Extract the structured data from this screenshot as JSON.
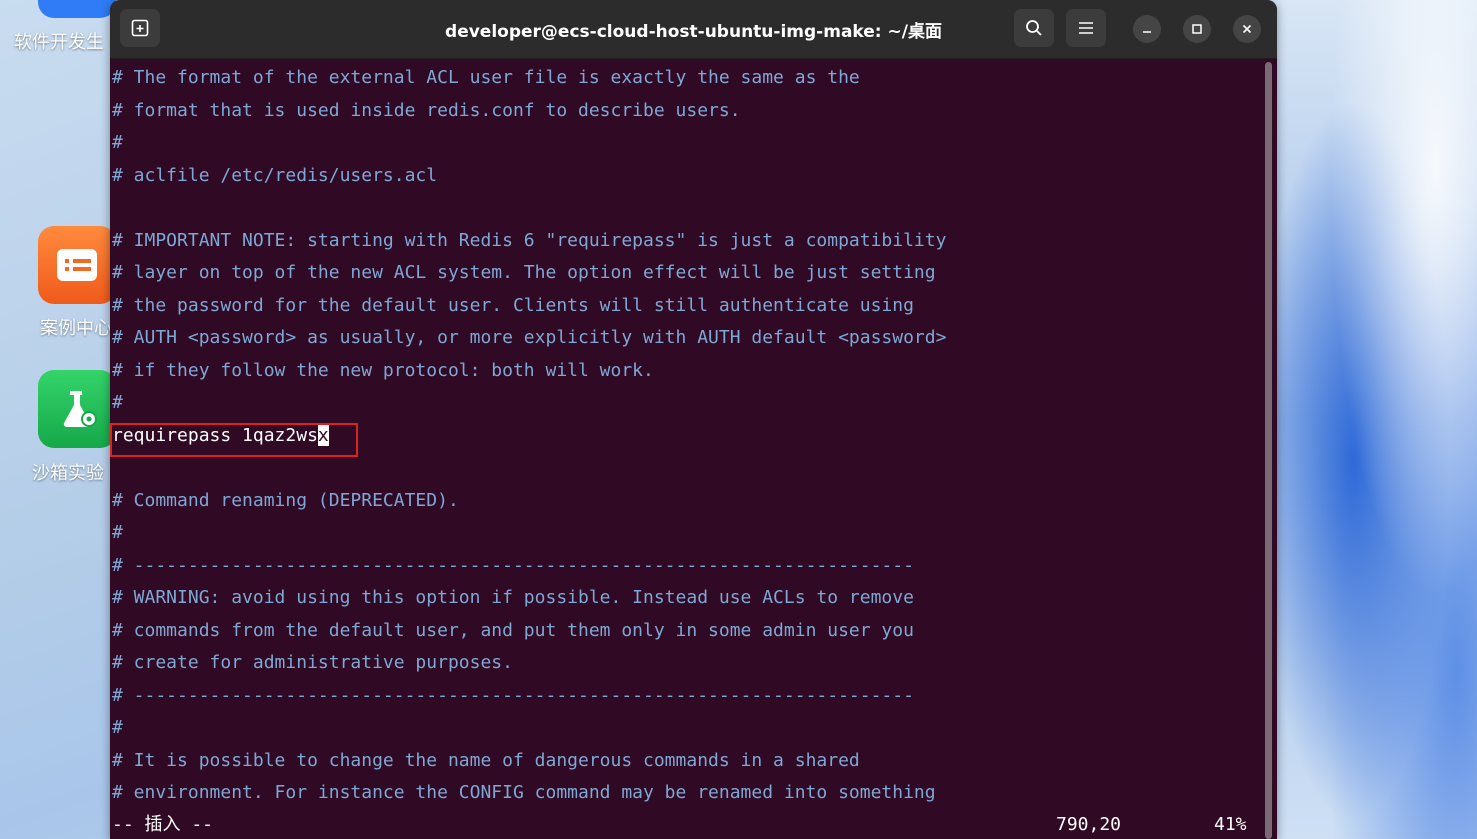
{
  "desktop": {
    "items": [
      {
        "label": "软件开发生",
        "icon": "app-icon"
      },
      {
        "label": "案例中心",
        "icon": "document-list-icon"
      },
      {
        "label": "沙箱实验",
        "icon": "flask-gear-icon"
      }
    ]
  },
  "window": {
    "title": "developer@ecs-cloud-host-ubuntu-img-make: ~/桌面"
  },
  "editor": {
    "lines": [
      "# The format of the external ACL user file is exactly the same as the",
      "# format that is used inside redis.conf to describe users.",
      "#",
      "# aclfile /etc/redis/users.acl",
      "",
      "# IMPORTANT NOTE: starting with Redis 6 \"requirepass\" is just a compatibility",
      "# layer on top of the new ACL system. The option effect will be just setting",
      "# the password for the default user. Clients will still authenticate using",
      "# AUTH <password> as usually, or more explicitly with AUTH default <password>",
      "# if they follow the new protocol: both will work.",
      "#",
      "",
      "",
      "# Command renaming (DEPRECATED).",
      "#",
      "# ------------------------------------------------------------------------",
      "# WARNING: avoid using this option if possible. Instead use ACLs to remove",
      "# commands from the default user, and put them only in some admin user you",
      "# create for administrative purposes.",
      "# ------------------------------------------------------------------------",
      "#",
      "# It is possible to change the name of dangerous commands in a shared",
      "# environment. For instance the CONFIG command may be renamed into something"
    ],
    "active_line_before_cursor": "requirepass 1qaz2ws",
    "cursor_char": "x"
  },
  "status": {
    "mode": "-- 插入 --",
    "position": "790,20",
    "percent": "41%"
  },
  "colors": {
    "terminal_bg": "#300a24",
    "comment": "#7fa7d4",
    "highlight_box": "#e02020"
  }
}
